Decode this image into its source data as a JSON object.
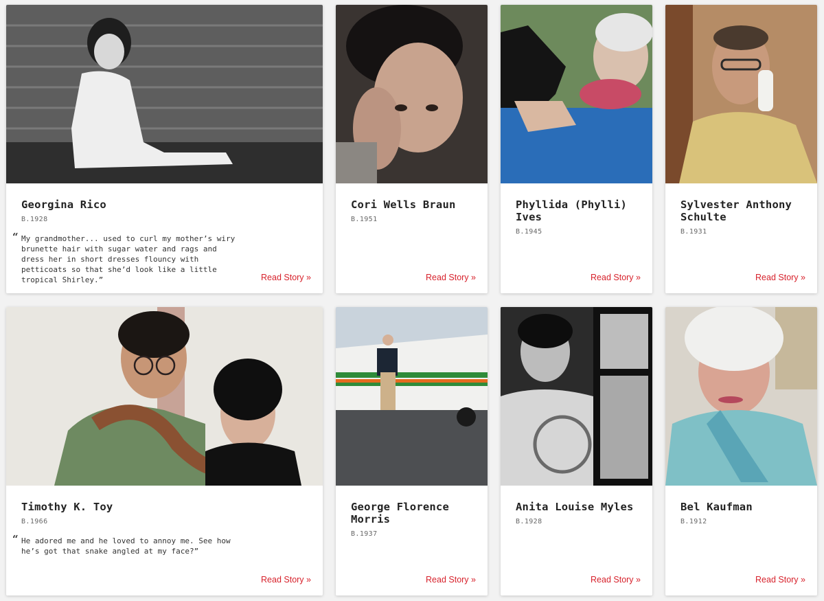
{
  "read_label": "Read Story »",
  "accent_color": "#d7212b",
  "stories": [
    {
      "name": "Georgina Rico",
      "birth": "B.1928",
      "quote": "My grandmother... used to curl my mother’s wiry brunette hair with sugar water and rags and dress her in short dresses flouncy with petticoats so that she’d look like a little tropical Shirley.”"
    },
    {
      "name": "Cori Wells Braun",
      "birth": "B.1951"
    },
    {
      "name": "Phyllida (Phylli) Ives",
      "birth": "B.1945"
    },
    {
      "name": "Sylvester Anthony Schulte",
      "birth": "B.1931"
    },
    {
      "name": "Timothy K. Toy",
      "birth": "B.1966",
      "quote": "He adored me and he loved to annoy me. See how he’s got that snake angled at my face?”"
    },
    {
      "name": "George Florence Morris",
      "birth": "B.1937"
    },
    {
      "name": "Anita Louise Myles",
      "birth": "B.1928"
    },
    {
      "name": "Bel Kaufman",
      "birth": "B.1912"
    }
  ]
}
